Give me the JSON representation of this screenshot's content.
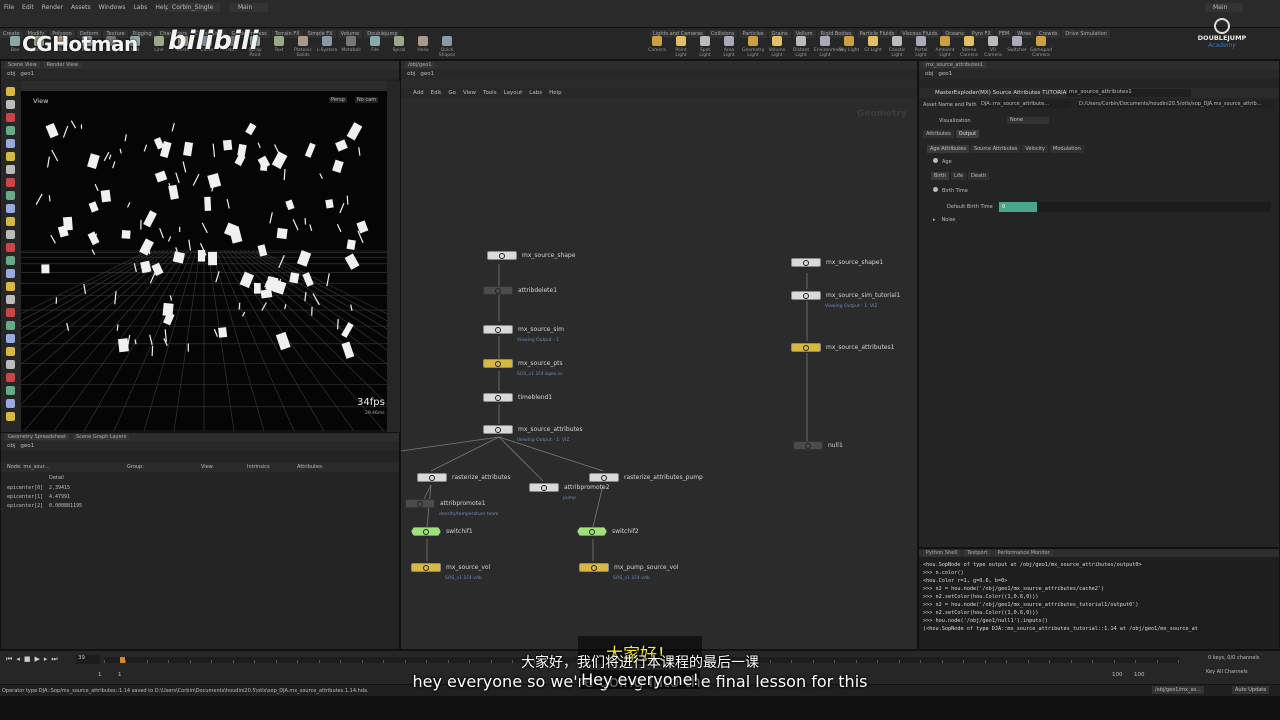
{
  "watermark": {
    "cg": "CGHotman",
    "bili": "bilibili",
    "brand": "DOUBLEJUMP",
    "brand_sub": "Academy"
  },
  "menu": [
    "File",
    "Edit",
    "Render",
    "Assets",
    "Windows",
    "Labs",
    "Help"
  ],
  "desktop": {
    "scene": "Corbin_Single",
    "main": "Main"
  },
  "shelf_left_tabs": [
    "Create",
    "Modify",
    "Polygon",
    "Deform",
    "Texture",
    "Rigging",
    "Characters",
    "Constraints",
    "Guide Process",
    "Terrain FX",
    "Simple FX",
    "Volume",
    "Doublejump"
  ],
  "shelf_left_tools": [
    "Box",
    "Sphere",
    "Tube",
    "Torus",
    "Grid",
    "Null",
    "Line",
    "Circle",
    "Curve",
    "Path",
    "Spray Paint",
    "Text",
    "Platonic Solids",
    "L-System",
    "Metaball",
    "File",
    "Spiral",
    "Helix",
    "Quick Shapes"
  ],
  "shelf_right_tabs": [
    "Lights and Cameras",
    "Collisions",
    "Particles",
    "Grains",
    "Vellum",
    "Rigid Bodies",
    "Particle Fluids",
    "Viscous Fluids",
    "Oceans",
    "Pyro FX",
    "FEM",
    "Wires",
    "Crowds",
    "Drive Simulation"
  ],
  "shelf_right_tools": [
    "Camera",
    "Point Light",
    "Spot Light",
    "Area Light",
    "Geometry Light",
    "Volume Light",
    "Distant Light",
    "Environment Light",
    "Sky Light",
    "GI Light",
    "Caustic Light",
    "Portal Light",
    "Ambient Light",
    "Stereo Camera",
    "VR Camera",
    "Switcher",
    "Gamepad Camera"
  ],
  "scene_view": {
    "tabs": [
      "Scene View",
      "Render View"
    ],
    "path": [
      "obj",
      "geo1"
    ],
    "label": "View",
    "persp": "Persp",
    "cam": "No cam",
    "fps": "34fps",
    "ms": "29.46ms"
  },
  "spreadsheet": {
    "tabs": [
      "Geometry Spreadsheet",
      "Scene Graph Layers"
    ],
    "path": [
      "obj",
      "geo1"
    ],
    "node_label": "Node: mx_sour...",
    "group_label": "Group:",
    "view_label": "View",
    "intrinsics": "Intrinsics",
    "attributes": "Attributes:",
    "column": "Detail",
    "rows": [
      {
        "name": "epicenter[0]",
        "value": "2.39415"
      },
      {
        "name": "epicenter[1]",
        "value": "4.47991"
      },
      {
        "name": "epicenter[2]",
        "value": "0.000881195"
      }
    ]
  },
  "network": {
    "tabs": [
      "/obj/geo1"
    ],
    "path": [
      "obj",
      "geo1"
    ],
    "menu": [
      "Add",
      "Edit",
      "Go",
      "View",
      "Tools",
      "Layout",
      "Labs",
      "Help"
    ],
    "context": "Geometry",
    "nodes": [
      {
        "name": "mx_source_shape",
        "sub": ""
      },
      {
        "name": "attribdelete1",
        "sub": ""
      },
      {
        "name": "mx_source_sim",
        "sub": "Viewing Output - 1"
      },
      {
        "name": "mx_source_pts",
        "sub": "SOS_v1.1F4.bgeo.sc"
      },
      {
        "name": "timeblend1",
        "sub": ""
      },
      {
        "name": "mx_source_attributes",
        "sub": "Viewing Output - 1: VIZ"
      },
      {
        "name": "rasterize_attributes",
        "sub": ""
      },
      {
        "name": "attribpromote2",
        "sub": "pump"
      },
      {
        "name": "rasterize_attributes_pump",
        "sub": ""
      },
      {
        "name": "attribpromote1",
        "sub": "density/temperature team"
      },
      {
        "name": "switchif1",
        "sub": ""
      },
      {
        "name": "switchif2",
        "sub": ""
      },
      {
        "name": "mx_source_vol",
        "sub": "SOS_v1.1F4.vdb"
      },
      {
        "name": "mx_pump_source_vol",
        "sub": "SOS_v1.1F4.vdb"
      },
      {
        "name": "mx_source_shape1",
        "sub": ""
      },
      {
        "name": "mx_source_sim_tutorial1",
        "sub": "Viewing Output - 1: VIZ"
      },
      {
        "name": "mx_source_attributes1",
        "sub": ""
      },
      {
        "name": "null1",
        "sub": ""
      }
    ]
  },
  "params": {
    "tab": "mx_source_attributes1",
    "path": [
      "obj",
      "geo1"
    ],
    "title": "MasterExploder(MX) Source Attributes TUTORIAL",
    "node_name": "mx_source_attributes1",
    "asset_label": "Asset Name and Path",
    "asset_name": "DJA::mx_source_attribute...",
    "asset_path": "D:/Users/Corbin/Documents/houdini20.5/otls/sop_DJA.mx_source_attrib...",
    "visualization": "Visualization",
    "viz_value": "None",
    "tabs": [
      "Attributes",
      "Output"
    ],
    "subtabs": [
      "Age Attributes",
      "Source Attributes",
      "Velocity",
      "Modulation"
    ],
    "age": "Age",
    "age_tabs": [
      "Birth",
      "Life",
      "Death"
    ],
    "birth_time": "Birth Time",
    "default_birth_label": "Default Birth Time",
    "default_birth_value": "0",
    "default_birth_fraction": 0.14,
    "noise": "Noise"
  },
  "python": {
    "tabs": [
      "Python Shell",
      "Textport",
      "Performance Monitor"
    ],
    "lines": [
      "<hou.SopNode of type output at /obj/geo1/mx_source_attributes/output0>",
      ">>> n.color()",
      "<hou.Color r=1, g=0.6, b=0>",
      ">>> n2 = hou.node('/obj/geo1/mx_source_attributes/cache2')",
      ">>> n2.setColor(hou.Color((1,0.6,0)))",
      ">>> n2 = hou.node('/obj/geo1/mx_source_attributes_tutorial1/output0')",
      ">>> n2.setColor(hou.Color((1,0.6,0)))",
      ">>> hou.node('/obj/geo1/null1').inputs()",
      "(<hou.SopNode of type DJA::mx_source_attributes_tutorial::1.14 at /obj/geo1/mx_source_at"
    ]
  },
  "timeline": {
    "frame": "39",
    "start": "1",
    "start2": "1",
    "end": "100",
    "end2": "100",
    "keys": "0 keys, 0/0 channels",
    "keyall": "Key All Channels",
    "auto": "Auto Update",
    "obj_path": "/obj/geo1/mx_so..."
  },
  "status": "Operator type DJA::Sop/mx_source_attributes::1.14 saved to D:\\Users\\Corbin\\Documents\\houdini20.5\\otls\\sop_DJA.mx_source_attributes.1.14.hda.",
  "subtitles": {
    "cn_top": "大家好！",
    "cn_main": "大家好，我们将进行本课程的最后一课",
    "en_top": "Hey everyone!",
    "en_main": "hey everyone so we're going into the final lesson for this"
  },
  "colors": {
    "accent": "#d7b843",
    "ramp": "#4aa58f",
    "viz_blue": "#6f8ab3"
  }
}
